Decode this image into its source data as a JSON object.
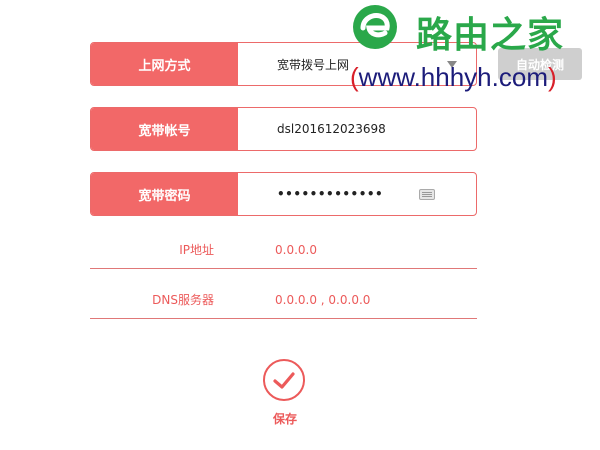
{
  "form": {
    "connection_type": {
      "label": "上网方式",
      "value": "宽带拨号上网",
      "detect_button": "自动检测"
    },
    "account": {
      "label": "宽带帐号",
      "value": "dsl201612023698"
    },
    "password": {
      "label": "宽带密码",
      "value": "•••••••••••••"
    },
    "ip": {
      "label": "IP地址",
      "value": "0.0.0.0"
    },
    "dns": {
      "label": "DNS服务器",
      "value": "0.0.0.0 , 0.0.0.0"
    },
    "save_label": "保存"
  },
  "watermark": {
    "title": "路由之家",
    "url_open": "(",
    "url_text": "www.hhhyh.com",
    "url_close": ")"
  },
  "colors": {
    "accent": "#f26868",
    "accent_text": "#ec5a5a",
    "border": "#ec6a6a",
    "watermark_green": "#2aa84a",
    "watermark_blue": "#1c1c7a",
    "watermark_red": "#d8202a"
  },
  "icons": {
    "dropdown": "chevron-down-icon",
    "keyboard": "keyboard-icon",
    "save": "checkmark-icon",
    "logo": "e-logo-icon"
  }
}
